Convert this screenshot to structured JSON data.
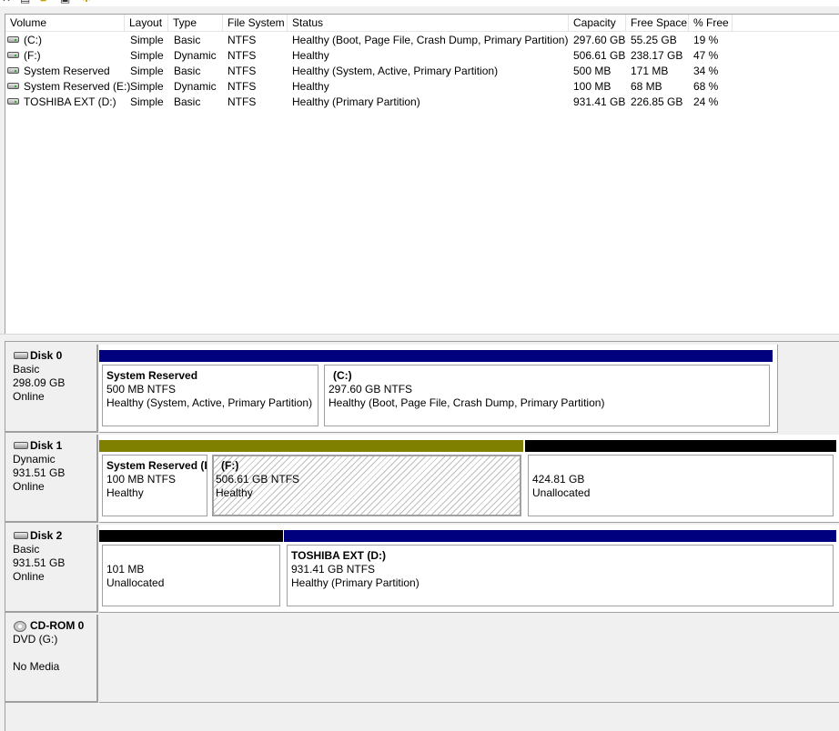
{
  "toolbar": {
    "icons": [
      "back-icon",
      "properties-icon",
      "help-icon",
      "zoom-icon",
      "settings-icon"
    ]
  },
  "volume_list": {
    "columns": [
      "Volume",
      "Layout",
      "Type",
      "File System",
      "Status",
      "Capacity",
      "Free Space",
      "% Free"
    ],
    "rows": [
      {
        "volume": "(C:)",
        "layout": "Simple",
        "type": "Basic",
        "fs": "NTFS",
        "status": "Healthy (Boot, Page File, Crash Dump, Primary Partition)",
        "capacity": "297.60 GB",
        "free": "55.25 GB",
        "pct": "19 %"
      },
      {
        "volume": "(F:)",
        "layout": "Simple",
        "type": "Dynamic",
        "fs": "NTFS",
        "status": "Healthy",
        "capacity": "506.61 GB",
        "free": "238.17 GB",
        "pct": "47 %"
      },
      {
        "volume": "System Reserved",
        "layout": "Simple",
        "type": "Basic",
        "fs": "NTFS",
        "status": "Healthy (System, Active, Primary Partition)",
        "capacity": "500 MB",
        "free": "171 MB",
        "pct": "34 %"
      },
      {
        "volume": "System Reserved (E:)",
        "layout": "Simple",
        "type": "Dynamic",
        "fs": "NTFS",
        "status": "Healthy",
        "capacity": "100 MB",
        "free": "68 MB",
        "pct": "68 %"
      },
      {
        "volume": "TOSHIBA EXT (D:)",
        "layout": "Simple",
        "type": "Basic",
        "fs": "NTFS",
        "status": "Healthy (Primary Partition)",
        "capacity": "931.41 GB",
        "free": "226.85 GB",
        "pct": "24 %"
      }
    ]
  },
  "disks": [
    {
      "name": "Disk 0",
      "type": "Basic",
      "size": "298.09 GB",
      "status": "Online",
      "partitions": [
        {
          "title": "System Reserved",
          "detail": "500 MB NTFS",
          "status": "Healthy (System, Active, Primary Partition)",
          "bar_color": "#00007f"
        },
        {
          "title": "(C:)",
          "detail": "297.60 GB NTFS",
          "status": "Healthy (Boot, Page File, Crash Dump, Primary Partition)",
          "bar_color": "#00007f"
        }
      ]
    },
    {
      "name": "Disk 1",
      "type": "Dynamic",
      "size": "931.51 GB",
      "status": "Online",
      "partitions": [
        {
          "title": "System Reserved (E:)",
          "detail": "100 MB NTFS",
          "status": "Healthy",
          "bar_color": "#7f7f00"
        },
        {
          "title": "(F:)",
          "detail": "506.61 GB NTFS",
          "status": "Healthy",
          "bar_color": "#7f7f00",
          "selected": true
        },
        {
          "title": "",
          "detail": "424.81 GB",
          "status": "Unallocated",
          "bar_color": "#000000"
        }
      ]
    },
    {
      "name": "Disk 2",
      "type": "Basic",
      "size": "931.51 GB",
      "status": "Online",
      "partitions": [
        {
          "title": "",
          "detail": "101 MB",
          "status": "Unallocated",
          "bar_color": "#000000"
        },
        {
          "title": "TOSHIBA EXT  (D:)",
          "detail": "931.41 GB NTFS",
          "status": "Healthy (Primary Partition)",
          "bar_color": "#00007f"
        }
      ]
    }
  ],
  "cdrom": {
    "name": "CD-ROM 0",
    "drive": "DVD (G:)",
    "media": "No Media"
  }
}
